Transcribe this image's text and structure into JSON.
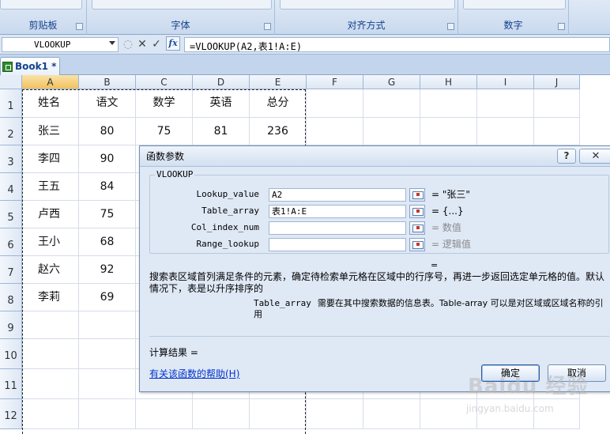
{
  "ribbon": {
    "groups": [
      "剪贴板",
      "字体",
      "对齐方式",
      "数字"
    ]
  },
  "formula_bar": {
    "name_box": "VLOOKUP",
    "cancel_glyph": "✕",
    "enter_glyph": "✓",
    "fx_label": "fx",
    "formula": "=VLOOKUP(A2,表1!A:E)"
  },
  "workbook": {
    "tab_label": "Book1 *"
  },
  "sheet": {
    "columns": [
      "A",
      "B",
      "C",
      "D",
      "E",
      "F",
      "G",
      "H",
      "I",
      "J"
    ],
    "rows": [
      "1",
      "2",
      "3",
      "4",
      "5",
      "6",
      "7",
      "8",
      "9",
      "10",
      "11",
      "12"
    ],
    "cells": [
      [
        "姓名",
        "语文",
        "数学",
        "英语",
        "总分"
      ],
      [
        "张三",
        "80",
        "75",
        "81",
        "236"
      ],
      [
        "李四",
        "90",
        "",
        "",
        ""
      ],
      [
        "王五",
        "84",
        "",
        "",
        ""
      ],
      [
        "卢西",
        "75",
        "",
        "",
        ""
      ],
      [
        "王小",
        "68",
        "",
        "",
        ""
      ],
      [
        "赵六",
        "92",
        "",
        "",
        ""
      ],
      [
        "李莉",
        "69",
        "",
        "",
        ""
      ]
    ]
  },
  "dialog": {
    "title": "函数参数",
    "help_glyph": "?",
    "close_glyph": "✕",
    "function_name": "VLOOKUP",
    "args": [
      {
        "label": "Lookup_value",
        "value": "A2",
        "result": "= \"张三\"",
        "hint": false
      },
      {
        "label": "Table_array",
        "value": "表1!A:E",
        "result": "= {...}",
        "hint": false
      },
      {
        "label": "Col_index_num",
        "value": "",
        "result": "= 数值",
        "hint": true
      },
      {
        "label": "Range_lookup",
        "value": "",
        "result": "= 逻辑值",
        "hint": true
      }
    ],
    "mid_equals": "=",
    "description": "搜索表区域首列满足条件的元素，确定待检索单元格在区域中的行序号，再进一步返回选定单元格的值。默认情况下，表是以升序排序的",
    "param_name": "Table_array",
    "param_description": "需要在其中搜索数据的信息表。Table-array 可以是对区域或区域名称的引用",
    "result_label": "计算结果 =",
    "help_link": "有关该函数的帮助(H)",
    "ok_label": "确定",
    "cancel_label": "取消"
  },
  "watermark": {
    "main": "Baidu 经验",
    "sub": "jingyan.baidu.com"
  }
}
